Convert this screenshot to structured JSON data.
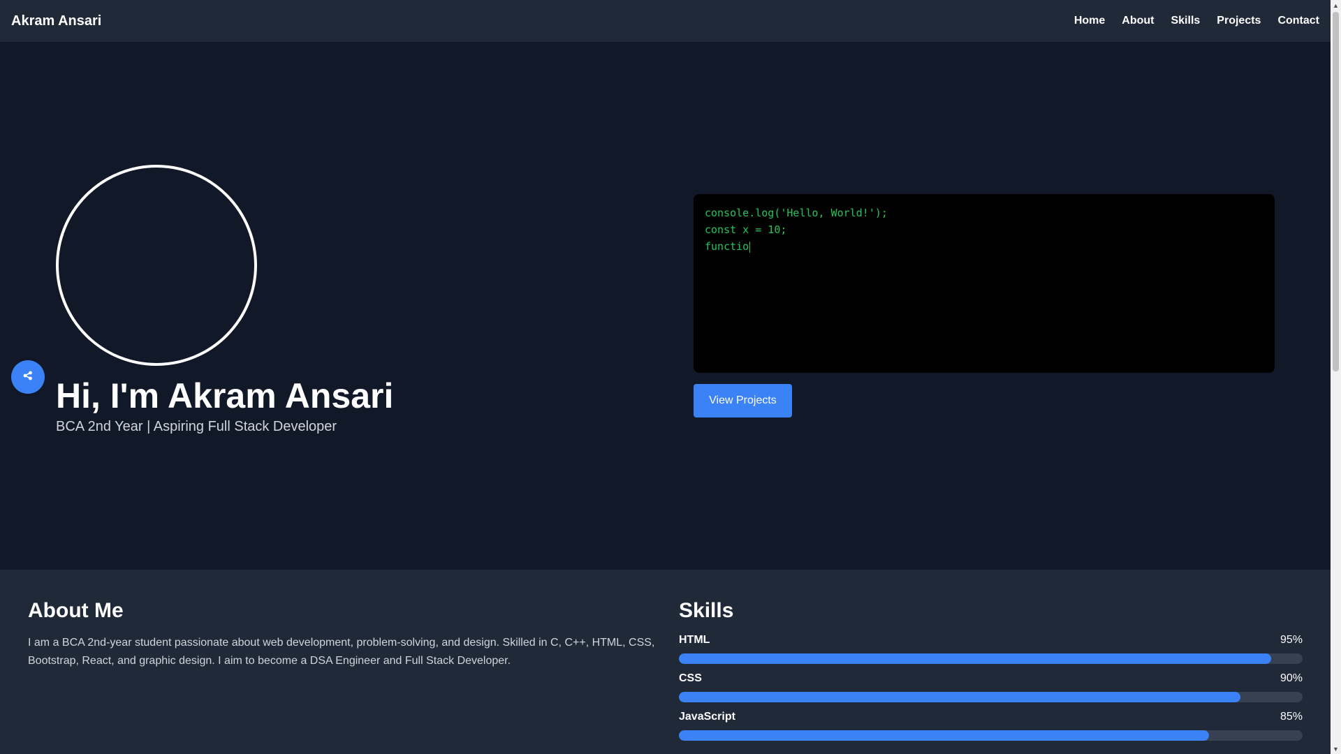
{
  "nav": {
    "brand": "Akram Ansari",
    "links": [
      "Home",
      "About",
      "Skills",
      "Projects",
      "Contact"
    ]
  },
  "hero": {
    "title": "Hi, I'm Akram Ansari",
    "subtitle": "BCA 2nd Year | Aspiring Full Stack Developer",
    "code_lines": [
      "console.log('Hello, World!');",
      "const x = 10;",
      "functio"
    ],
    "cta_label": "View Projects",
    "share_icon": "share-icon"
  },
  "about": {
    "title": "About Me",
    "text": "I am a BCA 2nd-year student passionate about web development, problem-solving, and design. Skilled in C, C++, HTML, CSS, Bootstrap, React, and graphic design. I aim to become a DSA Engineer and Full Stack Developer."
  },
  "skills": {
    "title": "Skills",
    "items": [
      {
        "name": "HTML",
        "percent_label": "95%",
        "level": 95
      },
      {
        "name": "CSS",
        "percent_label": "90%",
        "level": 90
      },
      {
        "name": "JavaScript",
        "percent_label": "85%",
        "level": 85
      }
    ]
  },
  "colors": {
    "page_bg": "#111827",
    "nav_bg": "#1f2937",
    "accent": "#3b82f6",
    "code_text": "#22c55e",
    "track": "#374151"
  }
}
